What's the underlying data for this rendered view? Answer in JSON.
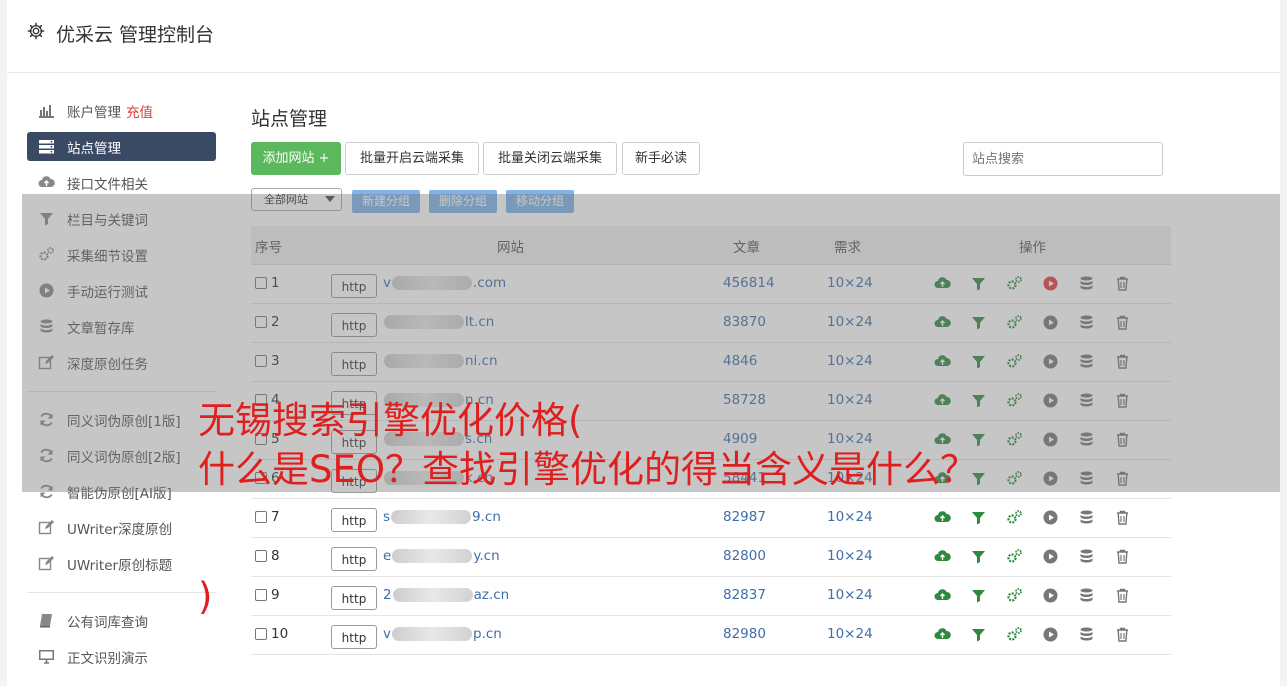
{
  "app": {
    "title": "优采云 管理控制台"
  },
  "sidebar": {
    "items": [
      {
        "label": "账户管理",
        "extra": "充值",
        "icon": "bar-chart-icon"
      },
      {
        "label": "站点管理",
        "icon": "server-icon",
        "active": true
      },
      {
        "label": "接口文件相关",
        "icon": "cloud-upload-icon"
      },
      {
        "label": "栏目与关键词",
        "icon": "filter-icon"
      },
      {
        "label": "采集细节设置",
        "icon": "gears-icon"
      },
      {
        "label": "手动运行测试",
        "icon": "play-circle-icon"
      },
      {
        "label": "文章暂存库",
        "icon": "database-icon"
      },
      {
        "label": "深度原创任务",
        "icon": "edit-icon"
      },
      {
        "label": "同义词伪原创[1版]",
        "icon": "refresh-icon"
      },
      {
        "label": "同义词伪原创[2版]",
        "icon": "refresh-icon"
      },
      {
        "label": "智能伪原创[AI版]",
        "icon": "refresh-icon"
      },
      {
        "label": "UWriter深度原创",
        "icon": "edit-icon"
      },
      {
        "label": "UWriter原创标题",
        "icon": "edit-icon"
      },
      {
        "label": "公有词库查询",
        "icon": "book-icon"
      },
      {
        "label": "正文识别演示",
        "icon": "monitor-icon"
      }
    ]
  },
  "main": {
    "title": "站点管理",
    "toolbar": {
      "add_label": "添加网站 +",
      "batch_on": "批量开启云端采集",
      "batch_off": "批量关闭云端采集",
      "guide": "新手必读",
      "search_placeholder": "站点搜索"
    },
    "group": {
      "select_value": "全部网站",
      "new_group": "新建分组",
      "delete_group": "删除分组",
      "move_group": "移动分组"
    },
    "table": {
      "headers": {
        "index": "序号",
        "site": "网站",
        "articles": "文章",
        "demand": "需求",
        "ops": "操作"
      },
      "rows": [
        {
          "index": "1",
          "proto": "http",
          "site_prefix": "v",
          "site_suffix": ".com",
          "articles": "456814",
          "demand": "10×24",
          "running": true
        },
        {
          "index": "2",
          "proto": "http",
          "site_prefix": "",
          "site_suffix": "lt.cn",
          "articles": "83870",
          "demand": "10×24"
        },
        {
          "index": "3",
          "proto": "http",
          "site_prefix": "",
          "site_suffix": "ni.cn",
          "articles": "4846",
          "demand": "10×24"
        },
        {
          "index": "4",
          "proto": "http",
          "site_prefix": "",
          "site_suffix": "n.cn",
          "articles": "58728",
          "demand": "10×24"
        },
        {
          "index": "5",
          "proto": "http",
          "site_prefix": "",
          "site_suffix": "s.cn",
          "articles": "4909",
          "demand": "10×24"
        },
        {
          "index": "6",
          "proto": "http",
          "site_prefix": "",
          "site_suffix": "k.cn",
          "articles": "58441",
          "demand": "10×24"
        },
        {
          "index": "7",
          "proto": "http",
          "site_prefix": "s",
          "site_suffix": "9.cn",
          "articles": "82987",
          "demand": "10×24"
        },
        {
          "index": "8",
          "proto": "http",
          "site_prefix": "e",
          "site_suffix": "y.cn",
          "articles": "82800",
          "demand": "10×24"
        },
        {
          "index": "9",
          "proto": "http",
          "site_prefix": "2",
          "site_suffix": "az.cn",
          "articles": "82837",
          "demand": "10×24"
        },
        {
          "index": "10",
          "proto": "http",
          "site_prefix": "v",
          "site_suffix": "p.cn",
          "articles": "82980",
          "demand": "10×24"
        }
      ]
    }
  },
  "overlay": {
    "line1": "无锡搜索引擎优化价格(",
    "line2": "什么是SEO？查找引擎优化的得当含义是什么？",
    "line3": ")"
  },
  "colors": {
    "accent_green": "#5cb85c",
    "sidebar_active": "#3b4a64",
    "link_blue": "#3d6fa8",
    "headline_red": "#e01e1e"
  }
}
